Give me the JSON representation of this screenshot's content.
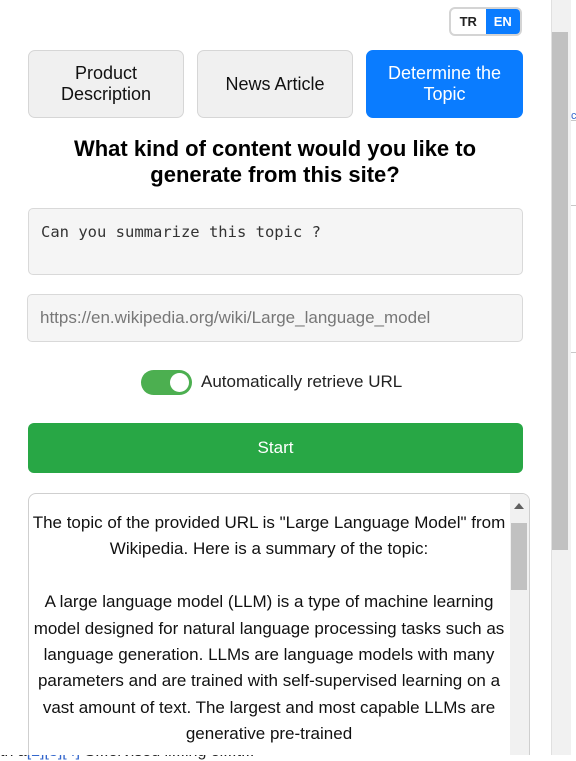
{
  "language_toggle": {
    "options": [
      "TR",
      "EN"
    ],
    "selected": "EN"
  },
  "tabs": [
    {
      "label_line1": "Product",
      "label_line2": "Description",
      "active": false
    },
    {
      "label": "News Article",
      "active": false
    },
    {
      "label_line1": "Determine the",
      "label_line2": "Topic",
      "active": true
    }
  ],
  "heading": {
    "line1": "What kind of content would you like to",
    "line2": "generate from this site?"
  },
  "prompt": {
    "value": "Can you summarize this topic ?"
  },
  "url_field": {
    "value": "https://en.wikipedia.org/wiki/Large_language_model"
  },
  "auto_retrieve": {
    "label": "Automatically retrieve URL",
    "enabled": true
  },
  "start_button": {
    "label": "Start"
  },
  "result": {
    "paragraph1": "The topic of the provided URL is \"Large Language Model\" from Wikipedia. Here is a summary of the topic:",
    "paragraph2": "A large language model (LLM) is a type of machine learning model designed for natural language processing tasks such as language generation. LLMs are language models with many parameters and are trained with self-supervised learning on a vast amount of text. The largest and most capable LLMs are generative pre-trained"
  },
  "background_page": {
    "partial_text_start": "th a",
    "partial_link": "[2][3][4]",
    "partial_text_end": " S...ervised li...ing el...t..."
  },
  "colors": {
    "accent_blue": "#0a7cff",
    "start_green": "#28a745",
    "switch_green": "#4caf50"
  }
}
